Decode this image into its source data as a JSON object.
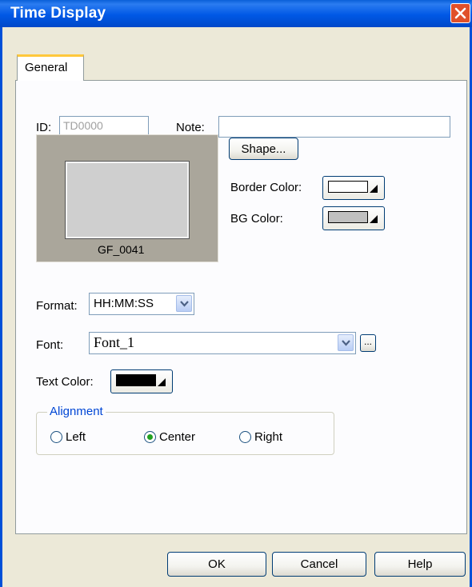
{
  "window": {
    "title": "Time Display"
  },
  "tabs": [
    {
      "label": "General"
    }
  ],
  "id_field": {
    "label": "ID:",
    "value": "TD0000"
  },
  "note_field": {
    "label": "Note:",
    "value": ""
  },
  "preview": {
    "shape_name": "GF_0041"
  },
  "shape_button": {
    "label": "Shape..."
  },
  "border_color": {
    "label": "Border Color:",
    "color": "#ffffff"
  },
  "bg_color": {
    "label": "BG Color:",
    "color": "#c0c0c0"
  },
  "format": {
    "label": "Format:",
    "value": "HH:MM:SS"
  },
  "font": {
    "label": "Font:",
    "value": "Font_1",
    "browse_label": "..."
  },
  "text_color": {
    "label": "Text Color:",
    "color": "#000000"
  },
  "alignment": {
    "label": "Alignment",
    "options": [
      {
        "label": "Left",
        "selected": false
      },
      {
        "label": "Center",
        "selected": true
      },
      {
        "label": "Right",
        "selected": false
      }
    ]
  },
  "buttons": {
    "ok": "OK",
    "cancel": "Cancel",
    "help": "Help"
  },
  "colors": {
    "titlebar": "#0058e6",
    "dialog_bg": "#ece9d8",
    "accent": "#0046d5"
  }
}
